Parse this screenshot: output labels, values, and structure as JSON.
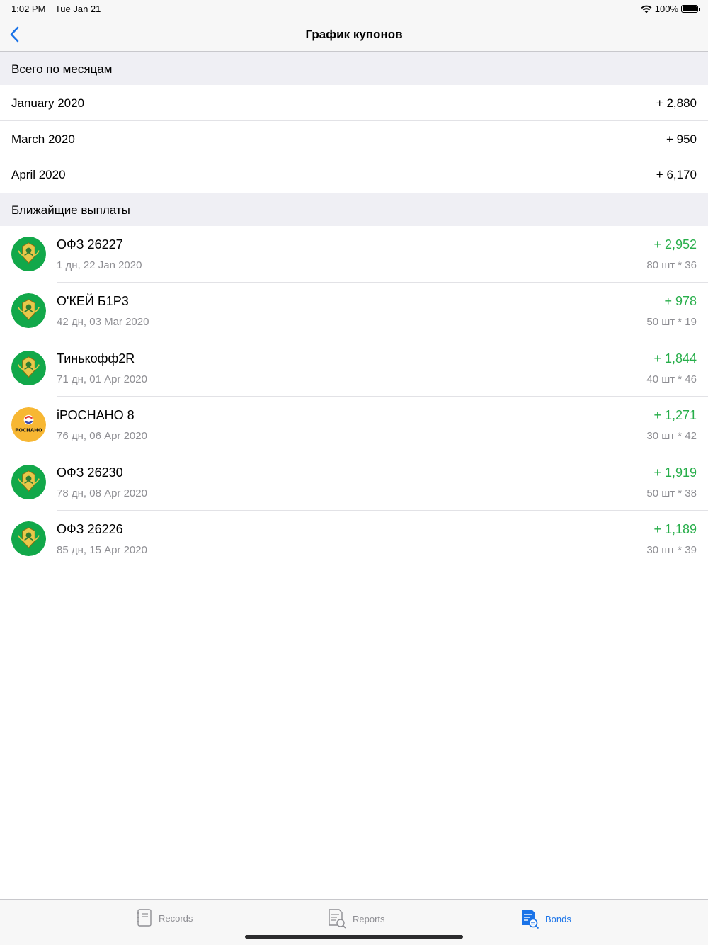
{
  "status": {
    "time": "1:02 PM",
    "date": "Tue Jan 21",
    "battery": "100%"
  },
  "nav": {
    "title": "График купонов"
  },
  "sections": {
    "monthly": "Всего по месяцам",
    "upcoming": "Ближайщие выплаты"
  },
  "months": [
    {
      "label": "January 2020",
      "value": "+ 2,880"
    },
    {
      "label": "March 2020",
      "value": "+ 950"
    },
    {
      "label": "April 2020",
      "value": "+ 6,170"
    }
  ],
  "payments": [
    {
      "name": "ОФЗ 26227",
      "date": "1 дн, 22 Jan 2020",
      "amount": "+ 2,952",
      "qty": "80 шт * 36",
      "logo": "ofz-emblem"
    },
    {
      "name": "О'КЕЙ Б1Р3",
      "date": "42 дн, 03 Mar 2020",
      "amount": "+ 978",
      "qty": "50 шт * 19",
      "logo": "ofz-emblem"
    },
    {
      "name": "Тинькофф2R",
      "date": "71 дн, 01 Apr 2020",
      "amount": "+ 1,844",
      "qty": "40 шт * 46",
      "logo": "ofz-emblem"
    },
    {
      "name": "iРОСНАНО 8",
      "date": "76 дн, 06 Apr 2020",
      "amount": "+ 1,271",
      "qty": "30 шт * 42",
      "logo": "rosnano-logo",
      "logo_text": "РОСНАНО"
    },
    {
      "name": "ОФЗ 26230",
      "date": "78 дн, 08 Apr 2020",
      "amount": "+ 1,919",
      "qty": "50 шт * 38",
      "logo": "ofz-emblem"
    },
    {
      "name": "ОФЗ 26226",
      "date": "85 дн, 15 Apr 2020",
      "amount": "+ 1,189",
      "qty": "30 шт * 39",
      "logo": "ofz-emblem"
    }
  ],
  "tabs": [
    {
      "label": "Records",
      "icon": "notebook-icon"
    },
    {
      "label": "Reports",
      "icon": "report-search-icon"
    },
    {
      "label": "Bonds",
      "icon": "bonds-icon",
      "active": true
    }
  ],
  "colors": {
    "accent": "#1a73e8",
    "positive": "#27ae4a",
    "ofz_green": "#12a84a",
    "rosnano_yellow": "#f7b733"
  }
}
